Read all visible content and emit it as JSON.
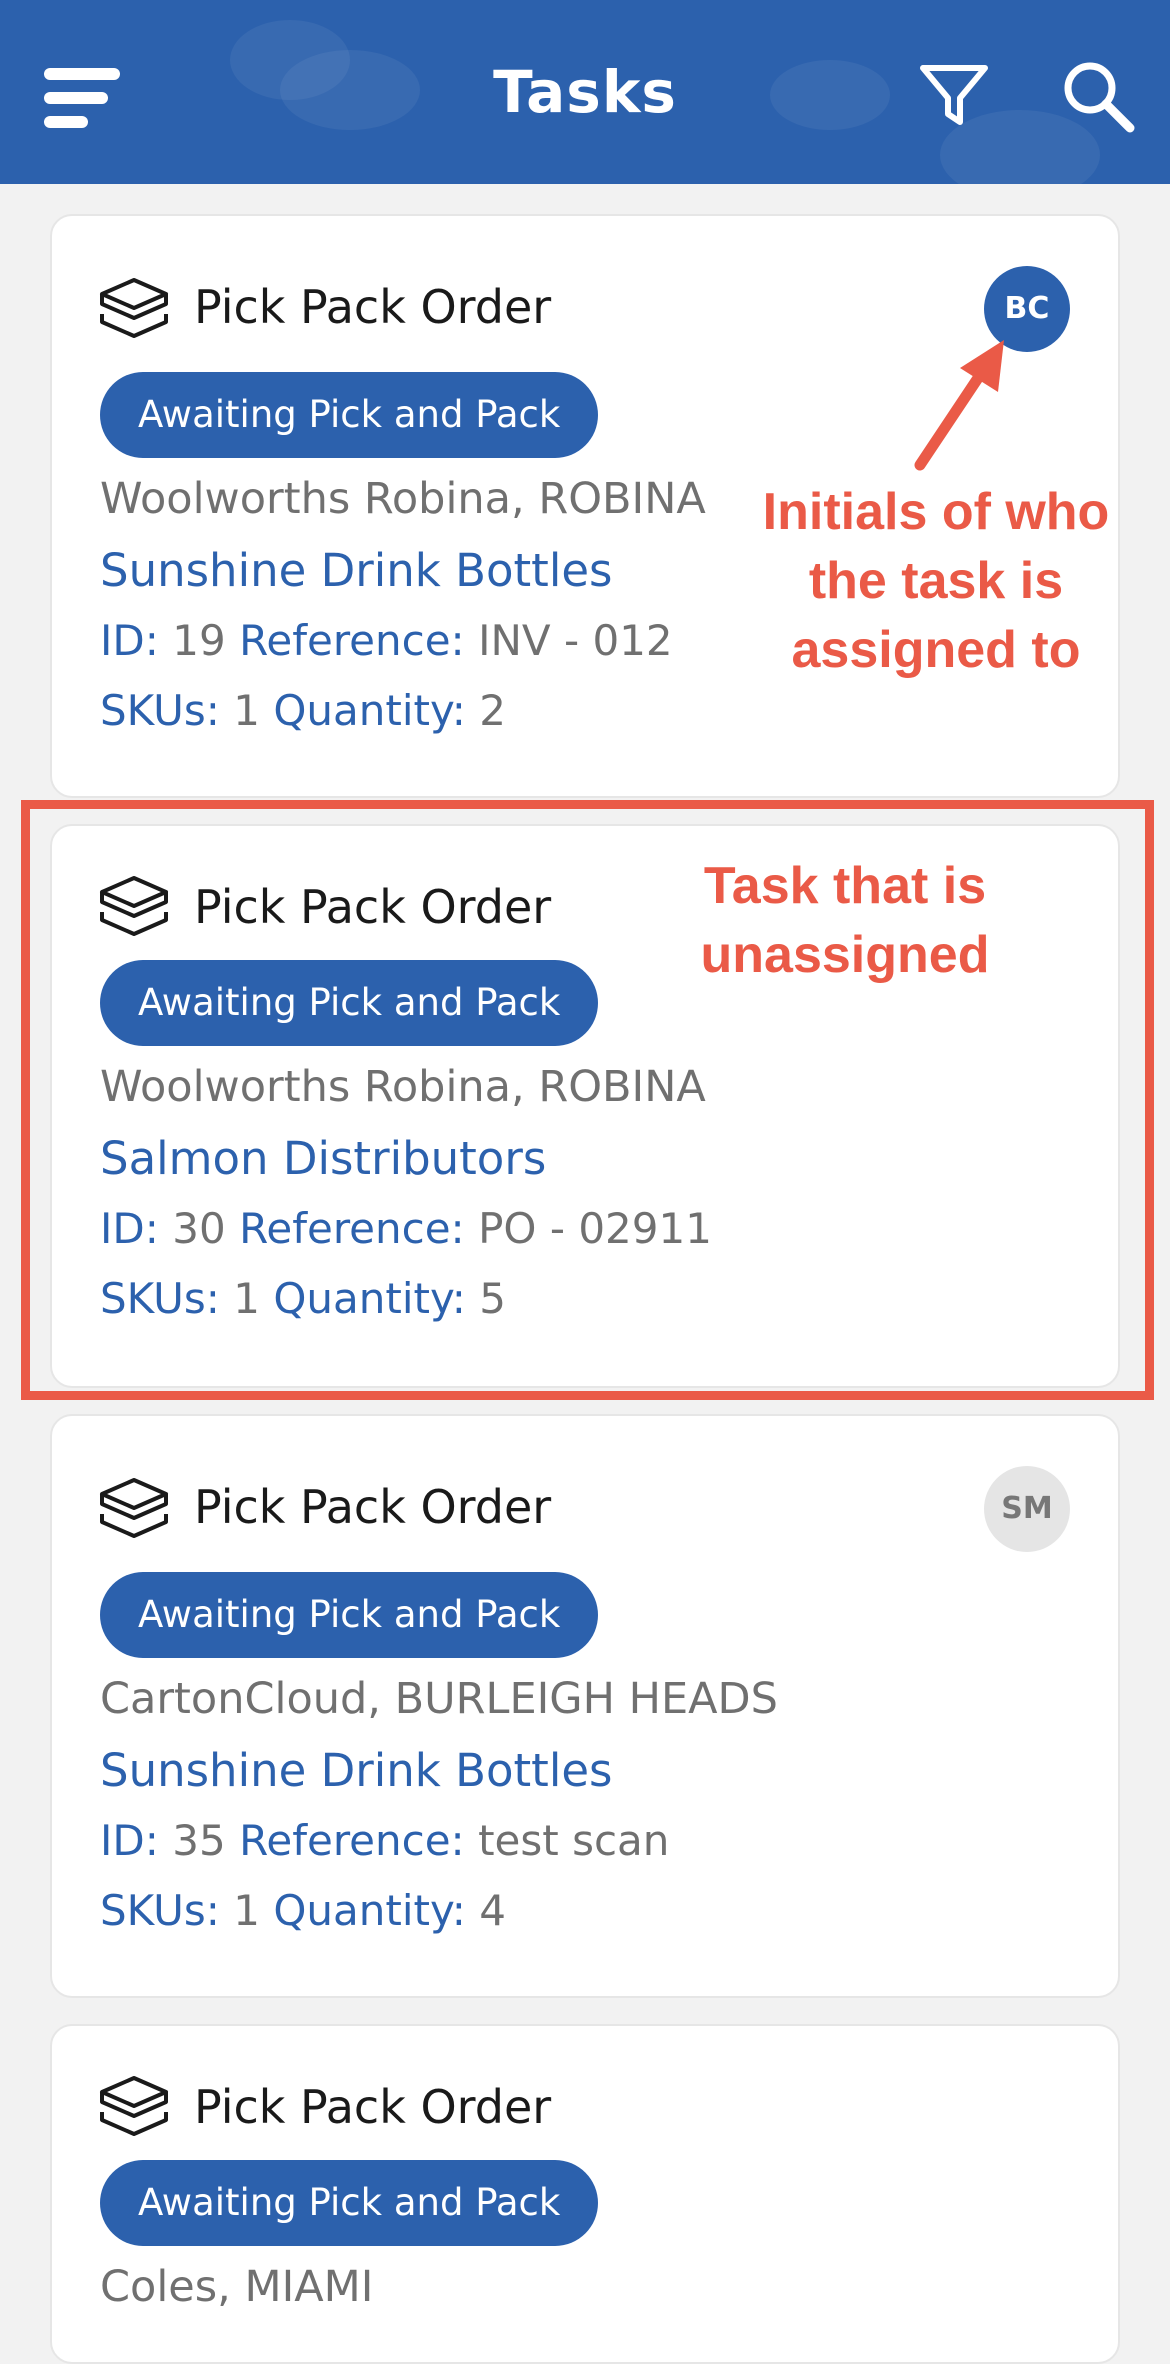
{
  "header": {
    "title": "Tasks",
    "menu_icon": "hamburger-menu-icon",
    "filter_icon": "filter-funnel-icon",
    "search_icon": "search-icon",
    "background_color": "#2c61ad"
  },
  "tasks": [
    {
      "type": "Pick Pack Order",
      "status": "Awaiting Pick and Pack",
      "location": "Woolworths Robina, ROBINA",
      "customer": "Sunshine Drink Bottles",
      "id_label": "ID:",
      "id": "19",
      "reference_label": "Reference:",
      "reference": "INV - 012",
      "skus_label": "SKUs:",
      "skus": "1",
      "quantity_label": "Quantity:",
      "quantity": "2",
      "assignee_initials": "BC"
    },
    {
      "type": "Pick Pack Order",
      "status": "Awaiting Pick and Pack",
      "location": "Woolworths Robina, ROBINA",
      "customer": "Salmon Distributors",
      "id_label": "ID:",
      "id": "30",
      "reference_label": "Reference:",
      "reference": "PO - 02911",
      "skus_label": "SKUs:",
      "skus": "1",
      "quantity_label": "Quantity:",
      "quantity": "5",
      "assignee_initials": ""
    },
    {
      "type": "Pick Pack Order",
      "status": "Awaiting Pick and Pack",
      "location": "CartonCloud, BURLEIGH HEADS",
      "customer": "Sunshine Drink Bottles",
      "id_label": "ID:",
      "id": "35",
      "reference_label": "Reference:",
      "reference": "test scan",
      "skus_label": "SKUs:",
      "skus": "1",
      "quantity_label": "Quantity:",
      "quantity": "4",
      "assignee_initials": "SM"
    },
    {
      "type": "Pick Pack Order",
      "status": "Awaiting Pick and Pack",
      "location": "Coles, MIAMI"
    }
  ],
  "annotations": {
    "assigned_line1": "Initials of who",
    "assigned_line2": "the task is",
    "assigned_line3": "assigned to",
    "unassigned_line1": "Task that is",
    "unassigned_line2": "unassigned",
    "color": "#ea5a47"
  },
  "task_icon": "box-package-icon"
}
